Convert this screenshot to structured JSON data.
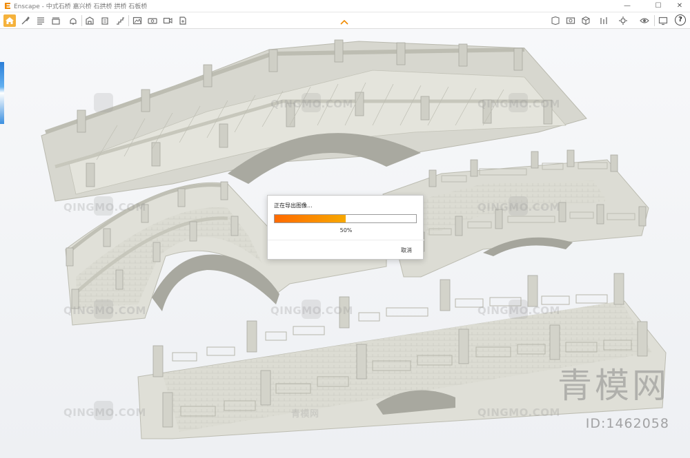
{
  "window": {
    "title": "Enscape - 中式石桥 嘉兴桥 石拱桥 拱桥 石板桥",
    "minimize": "—",
    "maximize": "☐",
    "close": "✕"
  },
  "toolbar": {
    "help_label": "?",
    "left_icons": [
      "home-icon",
      "brush-icon",
      "list-icon",
      "bim-icon",
      "bell-icon",
      "building-icon",
      "building-alt-icon",
      "stairs-icon",
      "export-image-icon",
      "export-panorama-icon",
      "video-icon",
      "batch-export-icon"
    ],
    "right_icons": [
      "asset-library-icon",
      "screenshot-icon",
      "cube-icon",
      "scale-icon",
      "settings-icon",
      "eye-icon"
    ],
    "accent_color": "#f5b23c"
  },
  "viewport": {
    "watermarks": [
      "QINGMO.COM",
      "QINGMO.COM",
      "QINGMO.COM",
      "QINGMO.COM",
      "QINGMO.COM",
      "QINGMO.COM",
      "QINGMO.COM",
      "QINGMO.COM",
      "QINGMO.COM"
    ],
    "small_watermark": "青模网",
    "brand": "青模网",
    "id_text": "ID:1462058"
  },
  "dialog": {
    "title": "正在导出图像...",
    "progress_percent": 50,
    "progress_label": "50%",
    "cancel_label": "取消",
    "progress_color_start": "#ff6a00",
    "progress_color_end": "#f7a800"
  }
}
